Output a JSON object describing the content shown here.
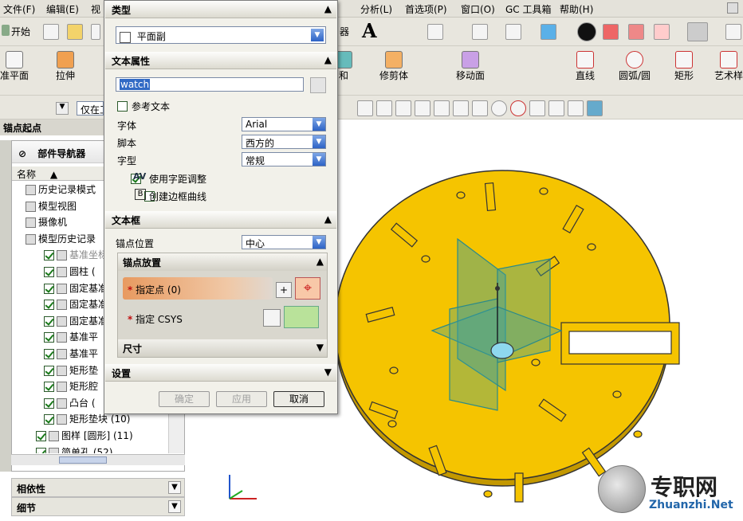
{
  "menubar": {
    "left_items": [
      "文件(F)",
      "编辑(E)",
      "视"
    ],
    "right_items": [
      "分析(L)",
      "首选项(P)",
      "窗口(O)",
      "GC 工具箱",
      "帮助(H)"
    ]
  },
  "toolbar1": {
    "start_label": "开始",
    "partial_label": "器"
  },
  "toolbar2": {
    "items": [
      "准平面",
      "拉伸",
      "和",
      "修剪体",
      "移动面",
      "直线",
      "圆弧/圆",
      "矩形",
      "艺术样"
    ]
  },
  "toolbar3": {
    "filter_value": "仅在工"
  },
  "left_panel": {
    "title": "锚点起点",
    "navigator_title": "部件导航器",
    "column_name": "名称",
    "tree": [
      {
        "label": "历史记录模式",
        "checked": false
      },
      {
        "label": "模型视图",
        "checked": false
      },
      {
        "label": "摄像机",
        "checked": true
      },
      {
        "label": "模型历史记录",
        "checked": false
      },
      {
        "label": "基准坐标",
        "checked": true
      },
      {
        "label": "圆柱 (",
        "checked": true
      },
      {
        "label": "固定基准",
        "checked": true
      },
      {
        "label": "固定基准",
        "checked": true
      },
      {
        "label": "固定基准",
        "checked": true
      },
      {
        "label": "基准平",
        "checked": true
      },
      {
        "label": "基准平",
        "checked": true
      },
      {
        "label": "矩形垫",
        "checked": true
      },
      {
        "label": "矩形腔",
        "checked": true
      },
      {
        "label": "凸台 (",
        "checked": true
      },
      {
        "label": "矩形垫块 (10)",
        "checked": true
      },
      {
        "label": "图样 [圆形] (11)",
        "checked": true
      },
      {
        "label": "简单孔 (52)",
        "checked": true
      }
    ],
    "relations_label": "相依性",
    "details_label": "细节"
  },
  "dialog": {
    "type_section": "类型",
    "type_value": "平面副",
    "text_props_section": "文本属性",
    "text_value": "watch",
    "ref_text_label": "参考文本",
    "font_label": "字体",
    "font_value": "Arial",
    "script_label": "脚本",
    "script_value": "西方的",
    "style_label": "字型",
    "style_value": "常规",
    "kerning_label": "使用字距调整",
    "border_label": "创建边框曲线",
    "frame_section": "文本框",
    "anchor_pos_label": "锚点位置",
    "anchor_pos_value": "中心",
    "anchor_place_section": "锚点放置",
    "specify_point_label": "指定点 (0)",
    "specify_csys_label": "指定 CSYS",
    "dims_section": "尺寸",
    "settings_section": "设置",
    "ok_label": "确定",
    "apply_label": "应用",
    "cancel_label": "取消"
  },
  "watermark": {
    "chinese": "专职网",
    "url": "Zhuanzhi.Net"
  },
  "colors": {
    "part_yellow": "#f5c400",
    "plane_teal": "#3aa0a0",
    "dialog_bg": "#f2f1ea"
  }
}
